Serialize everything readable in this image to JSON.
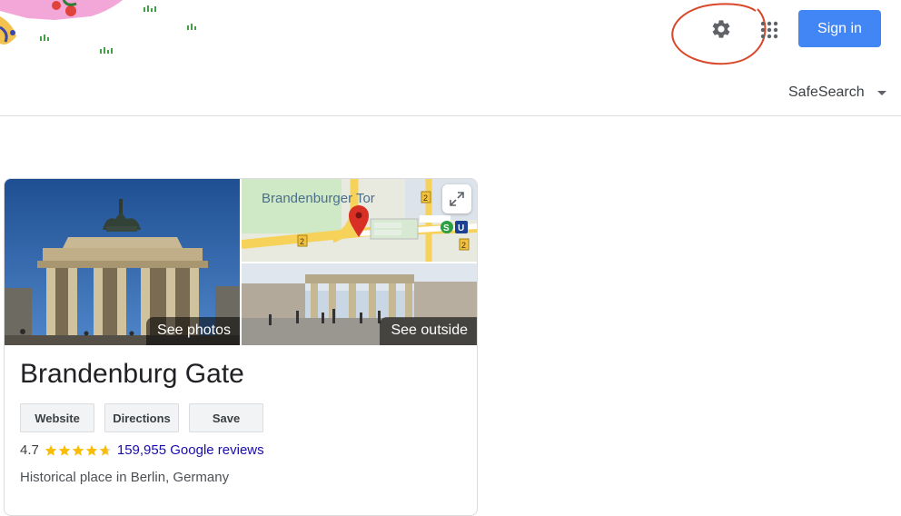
{
  "header": {
    "signin_label": "Sign in",
    "settings_icon": "gear-icon",
    "apps_icon": "apps-grid-icon",
    "annotation_color": "#d9472b",
    "accent_color": "#4285f4"
  },
  "filters": {
    "safesearch_label": "SafeSearch"
  },
  "knowledge_panel": {
    "title": "Brandenburg Gate",
    "photo_label": "See photos",
    "map": {
      "place_label": "Brandenburger Tor",
      "road_badge_a": "2",
      "road_badge_b": "2",
      "road_badge_c": "2",
      "sbahn_label": "S",
      "ubahn_label": "U"
    },
    "outside_label": "See outside",
    "buttons": {
      "website": "Website",
      "directions": "Directions",
      "save": "Save"
    },
    "rating": {
      "value": "4.7",
      "stars": 4.7,
      "reviews": "159,955 Google reviews"
    },
    "subtitle": "Historical place in Berlin, Germany"
  }
}
